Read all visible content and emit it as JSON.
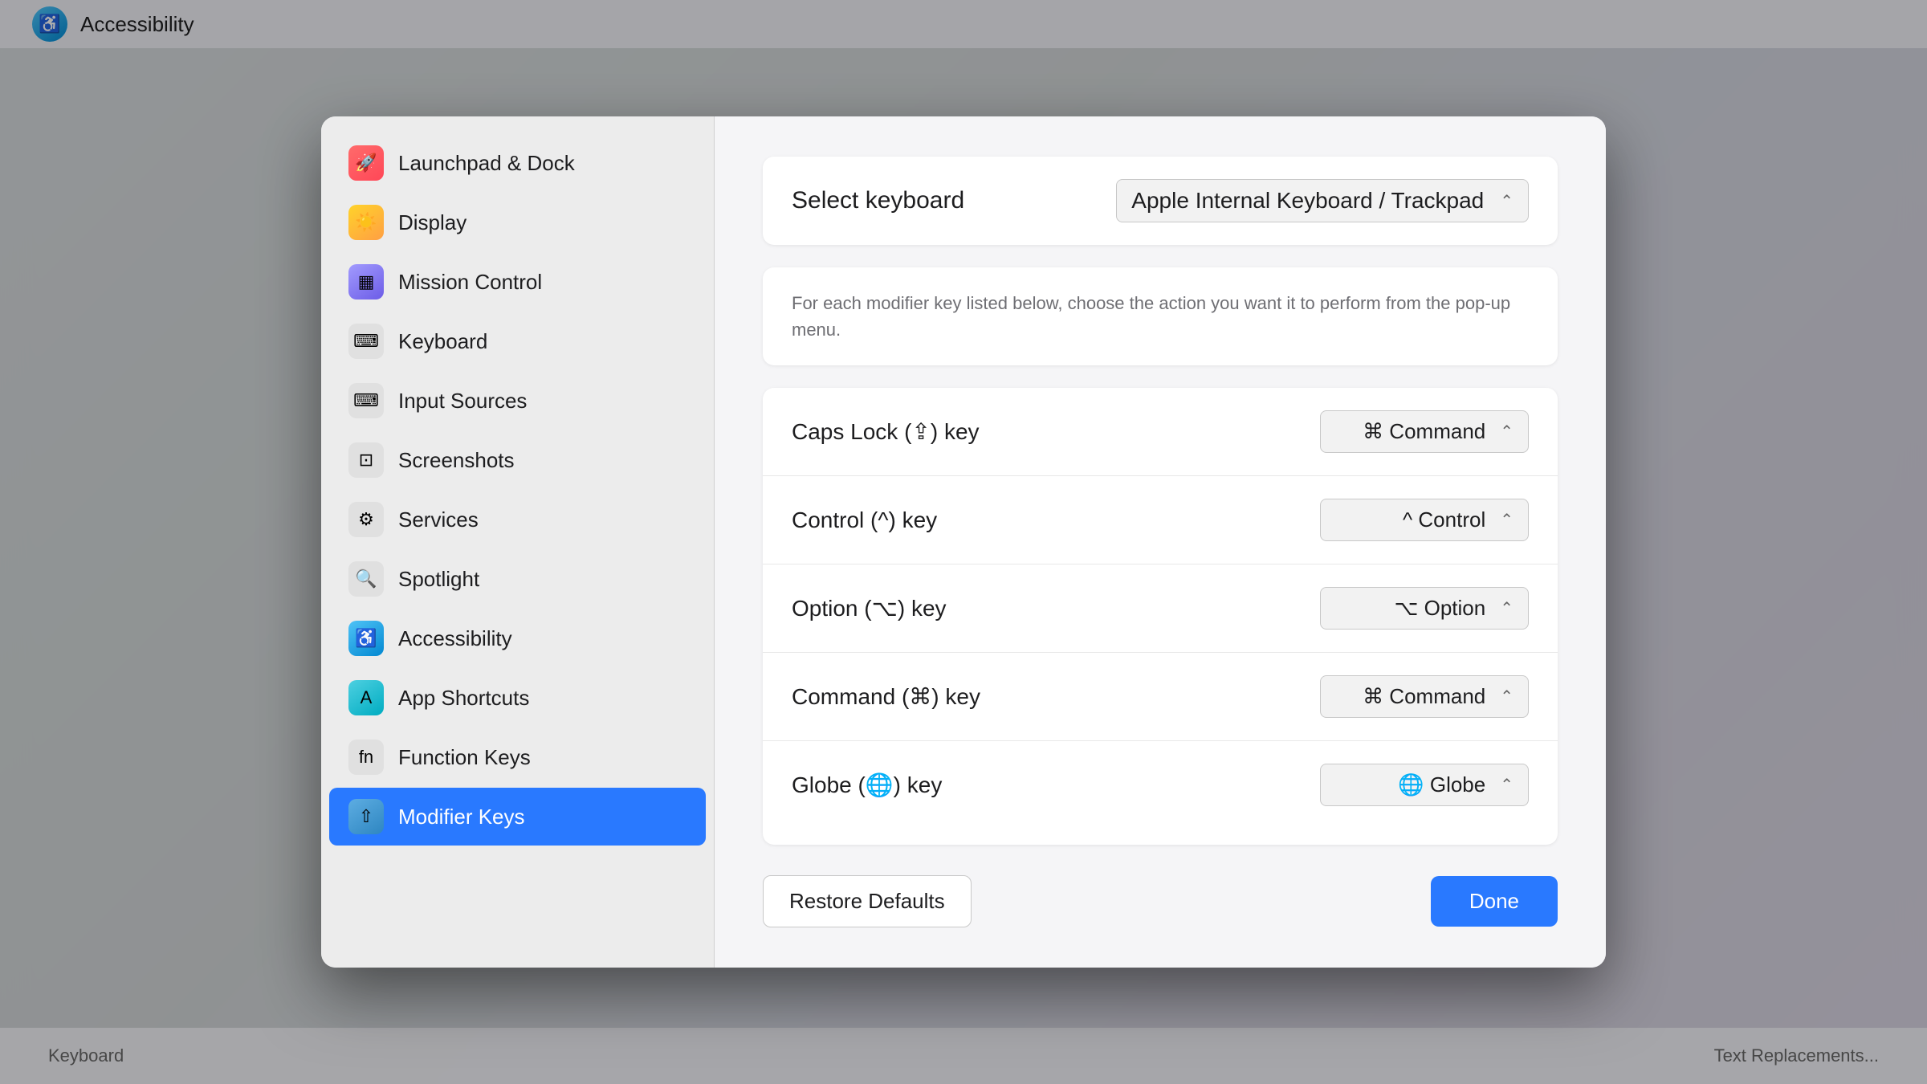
{
  "window": {
    "title": "Keyboard"
  },
  "sidebar": {
    "items": [
      {
        "id": "launchpad",
        "label": "Launchpad & Dock",
        "icon": "🚀",
        "icon_class": "icon-launchpad"
      },
      {
        "id": "display",
        "label": "Display",
        "icon": "☀️",
        "icon_class": "icon-display"
      },
      {
        "id": "mission",
        "label": "Mission Control",
        "icon": "▦",
        "icon_class": "icon-mission"
      },
      {
        "id": "keyboard",
        "label": "Keyboard",
        "icon": "⌨",
        "icon_class": "icon-keyboard"
      },
      {
        "id": "input",
        "label": "Input Sources",
        "icon": "⌨",
        "icon_class": "icon-input"
      },
      {
        "id": "screenshots",
        "label": "Screenshots",
        "icon": "⊡",
        "icon_class": "icon-screenshots"
      },
      {
        "id": "services",
        "label": "Services",
        "icon": "⚙",
        "icon_class": "icon-services"
      },
      {
        "id": "spotlight",
        "label": "Spotlight",
        "icon": "🔍",
        "icon_class": "icon-spotlight"
      },
      {
        "id": "accessibility",
        "label": "Accessibility",
        "icon": "♿",
        "icon_class": "icon-accessibility"
      },
      {
        "id": "appshortcuts",
        "label": "App Shortcuts",
        "icon": "A",
        "icon_class": "icon-appshortcuts"
      },
      {
        "id": "fnkeys",
        "label": "Function Keys",
        "icon": "fn",
        "icon_class": "icon-fnkeys"
      },
      {
        "id": "modifier",
        "label": "Modifier Keys",
        "icon": "⇧",
        "icon_class": "icon-modifier",
        "active": true
      }
    ]
  },
  "content": {
    "select_keyboard_label": "Select keyboard",
    "keyboard_value": "Apple Internal Keyboard / Trackpad",
    "description": "For each modifier key listed below, choose the action you want it to perform from the pop-up menu.",
    "modifier_rows": [
      {
        "id": "caps-lock",
        "label": "Caps Lock (⇪) key",
        "value": "⌘ Command",
        "symbol": "⌘"
      },
      {
        "id": "control",
        "label": "Control (^) key",
        "value": "^ Control",
        "symbol": "^"
      },
      {
        "id": "option",
        "label": "Option (⌥) key",
        "value": "⌥ Option",
        "symbol": "⌥"
      },
      {
        "id": "command",
        "label": "Command (⌘) key",
        "value": "⌘ Command",
        "symbol": "⌘"
      },
      {
        "id": "globe",
        "label": "Globe (🌐) key",
        "value": "🌐 Globe",
        "symbol": "🌐"
      }
    ],
    "restore_defaults_label": "Restore Defaults",
    "done_label": "Done"
  },
  "top_bar": {
    "accessibility_label": "Accessibility"
  },
  "bottom_bar": {
    "keyboard_label": "Keyboard",
    "text_replacements_label": "Text Replacements..."
  }
}
